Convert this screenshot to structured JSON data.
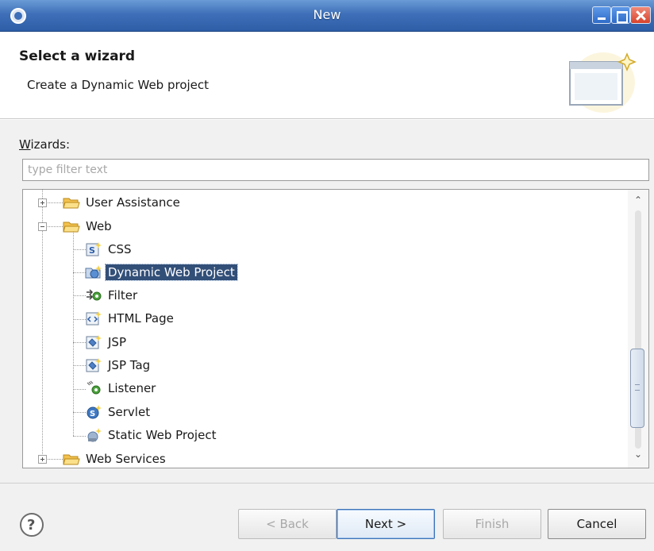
{
  "window": {
    "title": "New"
  },
  "header": {
    "heading": "Select a wizard",
    "description": "Create a Dynamic Web project"
  },
  "wizards": {
    "label": "Wizards:",
    "filter_placeholder": "type filter text",
    "tree": [
      {
        "label": "User Assistance",
        "type": "folder",
        "expander": "plus",
        "level": 0
      },
      {
        "label": "Web",
        "type": "folder",
        "expander": "minus",
        "level": 0
      },
      {
        "label": "CSS",
        "type": "item",
        "icon": "css-file-icon",
        "level": 1
      },
      {
        "label": "Dynamic Web Project",
        "type": "item",
        "icon": "dynamic-web-project-icon",
        "level": 1,
        "selected": true
      },
      {
        "label": "Filter",
        "type": "item",
        "icon": "filter-icon",
        "level": 1
      },
      {
        "label": "HTML Page",
        "type": "item",
        "icon": "html-page-icon",
        "level": 1
      },
      {
        "label": "JSP",
        "type": "item",
        "icon": "jsp-icon",
        "level": 1
      },
      {
        "label": "JSP Tag",
        "type": "item",
        "icon": "jsp-tag-icon",
        "level": 1
      },
      {
        "label": "Listener",
        "type": "item",
        "icon": "listener-icon",
        "level": 1
      },
      {
        "label": "Servlet",
        "type": "item",
        "icon": "servlet-icon",
        "level": 1
      },
      {
        "label": "Static Web Project",
        "type": "item",
        "icon": "static-web-project-icon",
        "level": 1
      },
      {
        "label": "Web Services",
        "type": "folder",
        "expander": "plus",
        "level": 0
      }
    ]
  },
  "buttons": {
    "back": "< Back",
    "next": "Next >",
    "finish": "Finish",
    "cancel": "Cancel"
  },
  "colors": {
    "titlebar": "#3e6fb8",
    "selection": "#324f78",
    "folder": "#f2c14e"
  }
}
